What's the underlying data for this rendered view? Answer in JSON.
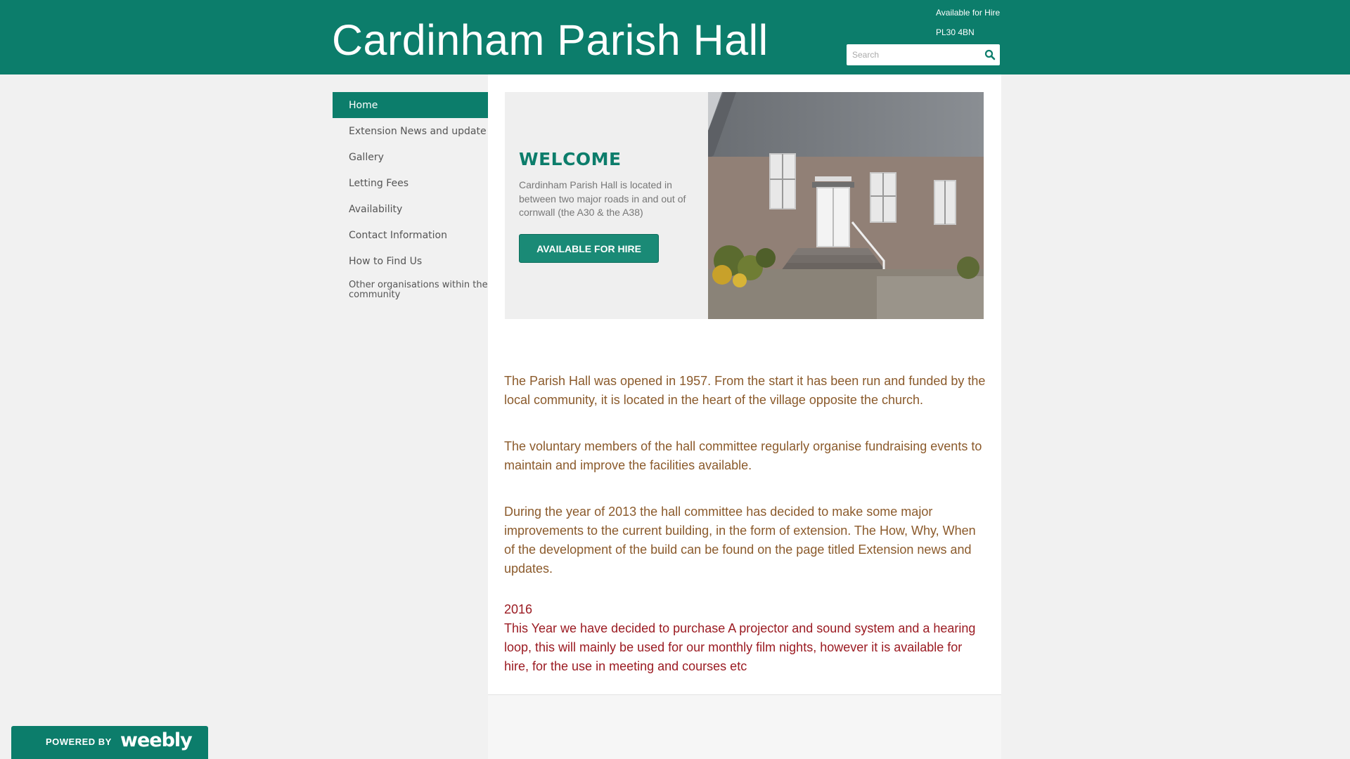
{
  "header": {
    "title": "Cardinham Parish Hall",
    "info_line1": "Available for Hire",
    "info_line2": "PL30 4BN",
    "search_placeholder": "Search",
    "search_icon": "search-icon"
  },
  "sidebar": {
    "items": [
      {
        "label": "Home",
        "active": true
      },
      {
        "label": "Extension News and update"
      },
      {
        "label": "Gallery"
      },
      {
        "label": "Letting Fees"
      },
      {
        "label": "Availability"
      },
      {
        "label": "Contact Information"
      },
      {
        "label": "How to Find Us"
      },
      {
        "label": "Other organisations within the community"
      }
    ]
  },
  "hero": {
    "heading": "WELCOME",
    "text": "Cardinham Parish Hall is located in between two major roads in and out of cornwall (the A30 & the A38)",
    "button_label": "AVAILABLE FOR HIRE"
  },
  "content": {
    "p1": "The Parish Hall was opened in 1957. From the start it has been run and funded by the local community, it is located in the heart of the village opposite the church.",
    "p2": "The voluntary members of the hall committee regularly organise fundraising events to maintain and improve the facilities available.",
    "p3": "During the year of 2013 the hall committee has decided to make some major improvements to the current building, in the form of extension. The How, Why, When of the development of the build can be found on the page titled Extension news and updates.",
    "year": "2016",
    "p4": "This Year we have decided to purchase A projector and sound system and a hearing loop, this will mainly be used for our monthly film nights, however it is available for hire, for the use in meeting and courses etc"
  },
  "badge": {
    "powered_by": "POWERED BY",
    "brand": "weebly"
  },
  "colors": {
    "brand": "#0c7d6b",
    "body_text": "#8b5a2b",
    "accent_red": "#9b1b22"
  }
}
